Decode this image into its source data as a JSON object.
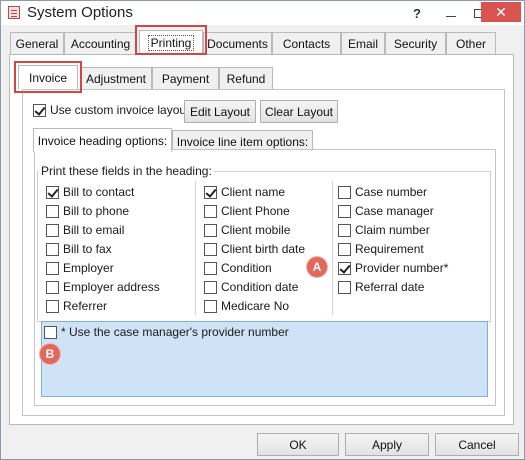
{
  "window": {
    "title": "System Options",
    "help": "?",
    "close": "✕"
  },
  "main_tabs": [
    {
      "label": "General"
    },
    {
      "label": "Accounting"
    },
    {
      "label": "Printing"
    },
    {
      "label": "Documents"
    },
    {
      "label": "Contacts"
    },
    {
      "label": "Email"
    },
    {
      "label": "Security"
    },
    {
      "label": "Other"
    }
  ],
  "printing_tabs": [
    {
      "label": "Invoice"
    },
    {
      "label": "Adjustment"
    },
    {
      "label": "Payment"
    },
    {
      "label": "Refund"
    }
  ],
  "invoice": {
    "custom_layout_label": "Use custom invoice layout:",
    "custom_layout_checked": true,
    "edit_layout": "Edit Layout",
    "clear_layout": "Clear Layout"
  },
  "option_tabs": [
    {
      "label": "Invoice heading options:"
    },
    {
      "label": "Invoice line item options:"
    }
  ],
  "heading_group": {
    "legend": "Print these fields in the heading:",
    "col1": [
      {
        "label": "Bill to contact",
        "checked": true
      },
      {
        "label": "Bill to phone",
        "checked": false
      },
      {
        "label": "Bill to email",
        "checked": false
      },
      {
        "label": "Bill to fax",
        "checked": false
      },
      {
        "label": "Employer",
        "checked": false
      },
      {
        "label": "Employer address",
        "checked": false
      },
      {
        "label": "Referrer",
        "checked": false
      }
    ],
    "col2": [
      {
        "label": "Client name",
        "checked": true
      },
      {
        "label": "Client Phone",
        "checked": false
      },
      {
        "label": "Client mobile",
        "checked": false
      },
      {
        "label": "Client birth date",
        "checked": false
      },
      {
        "label": "Condition",
        "checked": false
      },
      {
        "label": "Condition date",
        "checked": false
      },
      {
        "label": "Medicare No",
        "checked": false
      }
    ],
    "col3": [
      {
        "label": "Case number",
        "checked": false
      },
      {
        "label": "Case manager",
        "checked": false
      },
      {
        "label": "Claim number",
        "checked": false
      },
      {
        "label": "Requirement",
        "checked": false
      },
      {
        "label": "Provider number*",
        "checked": true
      },
      {
        "label": "Referral date",
        "checked": false
      }
    ]
  },
  "case_manager": {
    "label": "* Use the case manager's provider number",
    "checked": false
  },
  "markers": {
    "a": "A",
    "b": "B"
  },
  "footer": {
    "ok": "OK",
    "apply": "Apply",
    "cancel": "Cancel"
  },
  "colors": {
    "highlight": "#d64545",
    "marker": "#e0685c",
    "blue_panel": "#cfe3f6"
  }
}
